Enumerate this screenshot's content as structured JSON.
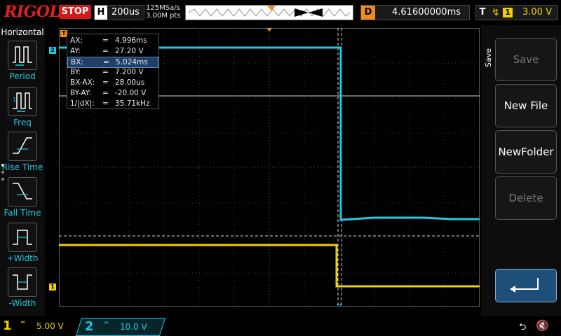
{
  "top": {
    "logo": "RIGOL",
    "run_state": "STOP",
    "timebase_label": "H",
    "timebase_value": "200us",
    "sample_rate": "125MSa/s",
    "memory_depth": "3.00M pts",
    "delay_label": "D",
    "delay_value": "4.61600000ms",
    "trigger_label": "T",
    "trigger_source": "1",
    "trigger_level": "3.00 V"
  },
  "left_menu": {
    "title": "Horizontal",
    "items": [
      {
        "label": "Period",
        "icon": "period-icon"
      },
      {
        "label": "Freq",
        "icon": "freq-icon"
      },
      {
        "label": "Rise Time",
        "icon": "rise-time-icon"
      },
      {
        "label": "Fall Time",
        "icon": "fall-time-icon"
      },
      {
        "label": "+Width",
        "icon": "positive-width-icon"
      },
      {
        "label": "-Width",
        "icon": "negative-width-icon"
      }
    ]
  },
  "cursors": {
    "rows": [
      {
        "key": "AX:",
        "eq": "=",
        "value": "4.996ms",
        "selected": false
      },
      {
        "key": "AY:",
        "eq": "=",
        "value": "27.20 V",
        "selected": false
      },
      {
        "key": "BX:",
        "eq": "=",
        "value": "5.024ms",
        "selected": true
      },
      {
        "key": "BY:",
        "eq": "=",
        "value": "7.200 V",
        "selected": false
      },
      {
        "key": "BX-AX:",
        "eq": "=",
        "value": "28.00us",
        "selected": false
      },
      {
        "key": "BY-AY:",
        "eq": "=",
        "value": "-20.00 V",
        "selected": false
      },
      {
        "key": "1/|dX|:",
        "eq": "=",
        "value": "35.71kHz",
        "selected": false
      }
    ]
  },
  "markers": {
    "ch2_marker": "2",
    "ch1_marker": "1",
    "trigger_marker": "T"
  },
  "right_menu": {
    "title": "Save",
    "buttons": [
      {
        "label": "Save",
        "enabled": false
      },
      {
        "label": "New File",
        "enabled": true
      },
      {
        "label": "NewFolder",
        "enabled": true
      },
      {
        "label": "Delete",
        "enabled": false
      },
      {
        "label": "",
        "enabled": true,
        "icon": "return-icon"
      }
    ]
  },
  "bottom": {
    "ch1_number": "1",
    "ch1_coupling": "DC",
    "ch1_scale": "5.00 V",
    "ch2_number": "2",
    "ch2_coupling": "DC",
    "ch2_scale": "10.0 V"
  },
  "colors": {
    "ch1": "#f0d000",
    "ch2": "#20c8e0",
    "trigger": "#f08c1e",
    "stop": "#d21a1a"
  }
}
